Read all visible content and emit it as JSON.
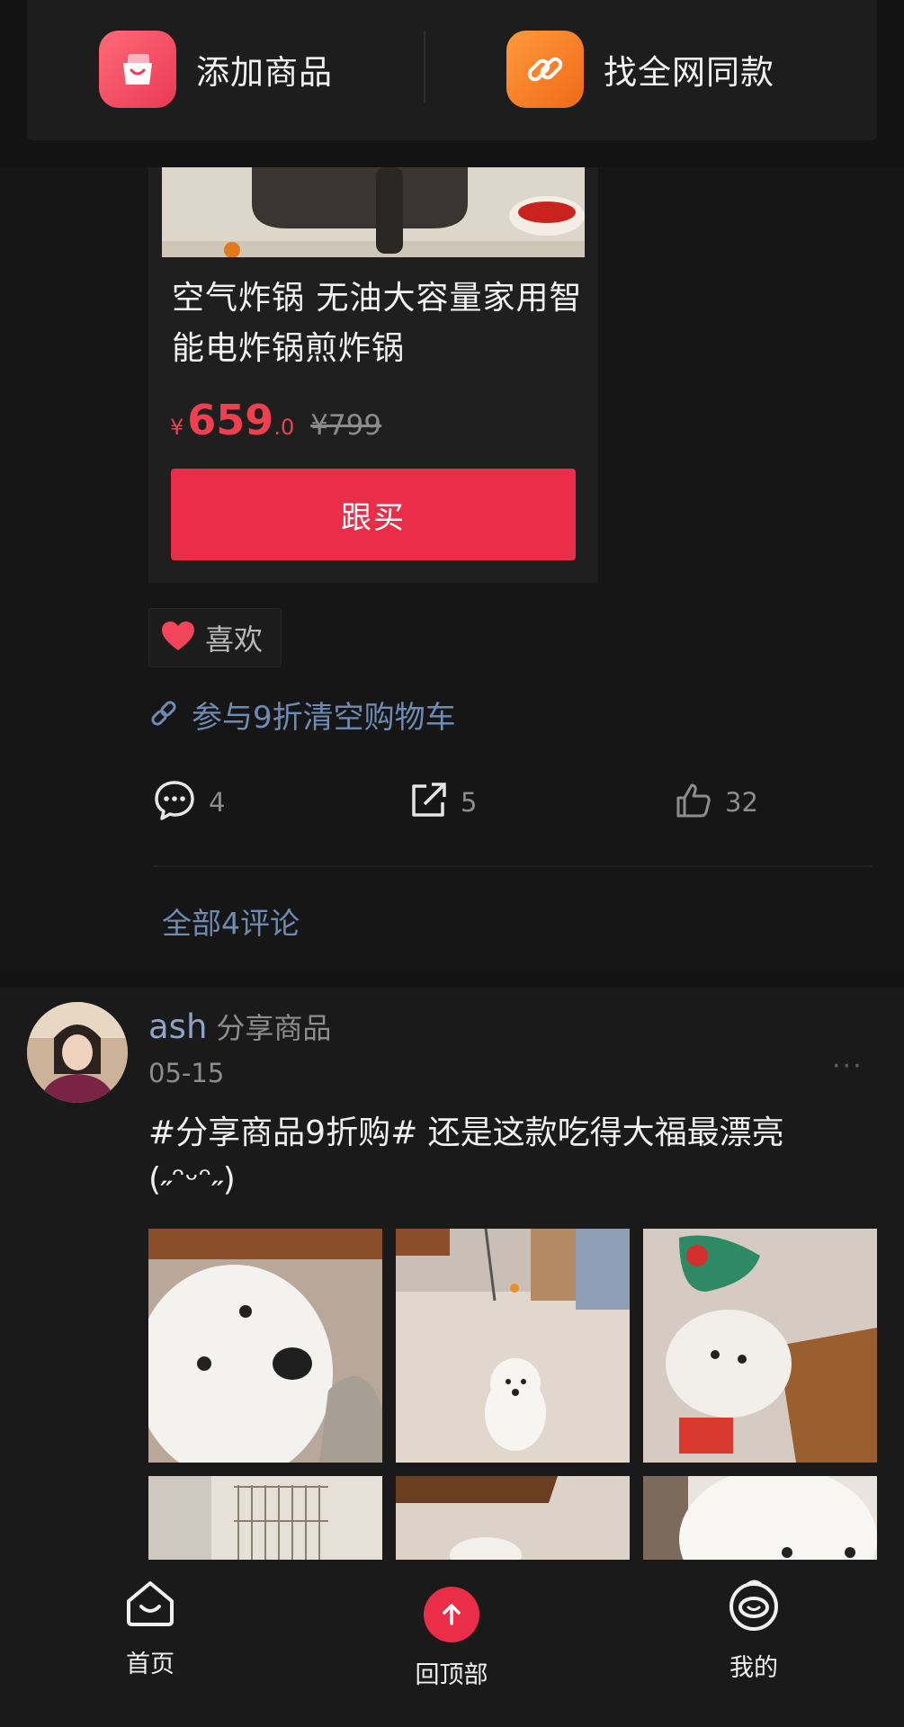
{
  "topbar": {
    "add_product_label": "添加商品",
    "find_same_label": "找全网同款",
    "add_icon": "shopping-bag-icon",
    "find_icon": "link-icon",
    "add_color": "#f04c5f",
    "find_color": "#f5822a"
  },
  "product": {
    "title": "空气炸锅 无油大容量家用智能电炸锅煎炸锅",
    "currency": "¥",
    "price_int": "659",
    "price_dec": ".0",
    "price_old": "¥799",
    "buy_label": "跟买",
    "accent_color": "#ea2d49"
  },
  "like_chip": {
    "label": "喜欢",
    "icon": "heart-icon"
  },
  "promo": {
    "label": "参与9折清空购物车",
    "icon": "link-icon"
  },
  "stats": {
    "comments": "4",
    "shares": "5",
    "likes": "32"
  },
  "all_comments_label": "全部4评论",
  "post2": {
    "user_name": "ash",
    "action": "分享商品",
    "date": "05-15",
    "more": "···",
    "text": "#分享商品9折购# 还是这款吃得大福最漂亮(˶ᵔᵕᵔ˶)",
    "images": [
      "dog-closeup",
      "dog-on-floor",
      "dog-with-toys",
      "dog-cage",
      "dog-under-table",
      "dog-face"
    ]
  },
  "bottom_nav": {
    "home_label": "首页",
    "top_label": "回顶部",
    "mine_label": "我的"
  }
}
